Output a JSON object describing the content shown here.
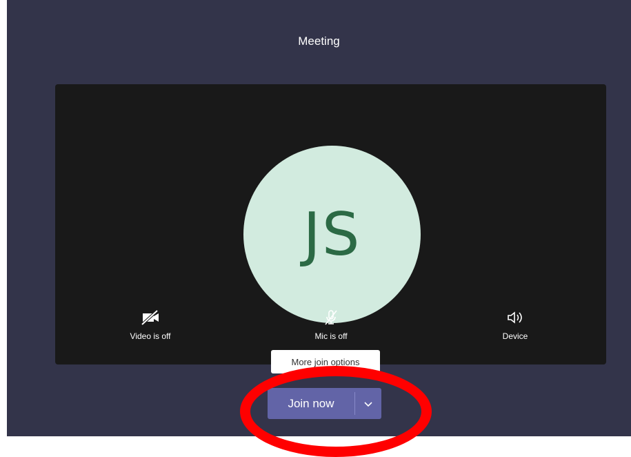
{
  "header": {
    "title": "Meeting"
  },
  "preview": {
    "avatar_initials": "JS"
  },
  "controls": {
    "video_label": "Video is off",
    "mic_label": "Mic is off",
    "device_label": "Device"
  },
  "tooltip": {
    "text": "More join options"
  },
  "join": {
    "label": "Join now"
  },
  "colors": {
    "background": "#33344a",
    "stage": "#191919",
    "avatar_bg": "#d2ebdf",
    "avatar_text": "#2c6a45",
    "accent": "#6264a7",
    "annotation": "#ff0000"
  },
  "icons": {
    "video": "video-off-icon",
    "mic": "mic-off-icon",
    "device": "speaker-icon",
    "caret": "chevron-down-icon"
  }
}
